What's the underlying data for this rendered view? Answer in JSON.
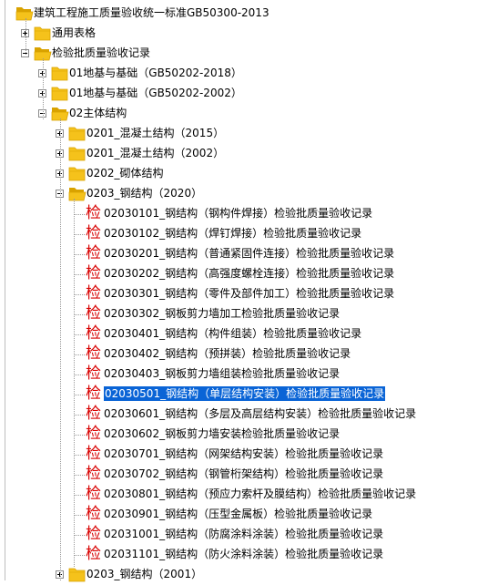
{
  "tree": {
    "root": {
      "label": "建筑工程施工质量验收统一标准GB50300-2013",
      "icon": "folder-open-icon"
    },
    "general": {
      "label": "通用表格",
      "icon": "folder-icon"
    },
    "batch": {
      "label": "检验批质量验收记录",
      "icon": "folder-open-icon"
    },
    "found2018": {
      "label": "01地基与基础（GB50202-2018）",
      "icon": "folder-icon"
    },
    "found2002": {
      "label": "01地基与基础（GB50202-2002）",
      "icon": "folder-icon"
    },
    "main": {
      "label": "02主体结构",
      "icon": "folder-open-icon"
    },
    "concrete2015": {
      "label": "0201_混凝土结构（2015）",
      "icon": "folder-icon"
    },
    "concrete2002": {
      "label": "0201_混凝土结构（2002）",
      "icon": "folder-icon"
    },
    "masonry": {
      "label": "0202_砌体结构",
      "icon": "folder-icon"
    },
    "steel2020": {
      "label": "0203_钢结构（2020）",
      "icon": "folder-open-icon"
    },
    "steel2001": {
      "label": "0203_钢结构（2001）",
      "icon": "folder-icon"
    },
    "doc_glyph": "检",
    "docs": [
      "02030101_钢结构（钢构件焊接）检验批质量验收记录",
      "02030102_钢结构（焊钉焊接）检验批质量验收记录",
      "02030201_钢结构（普通紧固件连接）检验批质量验收记录",
      "02030202_钢结构（高强度螺栓连接）检验批质量验收记录",
      "02030301_钢结构（零件及部件加工）检验批质量验收记录",
      "02030302_钢板剪力墙加工检验批质量验收记录",
      "02030401_钢结构（构件组装）检验批质量验收记录",
      "02030402_钢结构（预拼装）检验批质量验收记录",
      "02030403_钢板剪力墙组装检验批质量验收记录",
      "02030501_钢结构（单层结构安装）检验批质量验收记录",
      "02030601_钢结构（多层及高层结构安装）检验批质量验收记录",
      "02030602_钢板剪力墙安装检验批质量验收记录",
      "02030701_钢结构（网架结构安装）检验批质量验收记录",
      "02030702_钢结构（钢管桁架结构）检验批质量验收记录",
      "02030801_钢结构（预应力索杆及膜结构）检验批质量验收记录",
      "02030901_钢结构（压型金属板）检验批质量验收记录",
      "02031001_钢结构（防腐涂料涂装）检验批质量验收记录",
      "02031101_钢结构（防火涂料涂装）检验批质量验收记录"
    ],
    "selected_doc": "02030501_钢结构（单层结构安装）检验批质量验收记录"
  },
  "colors": {
    "folder": "#f5c21b",
    "folder_dark": "#d9a200",
    "doc_icon": "#d80000",
    "selection": "#0a64d6"
  }
}
